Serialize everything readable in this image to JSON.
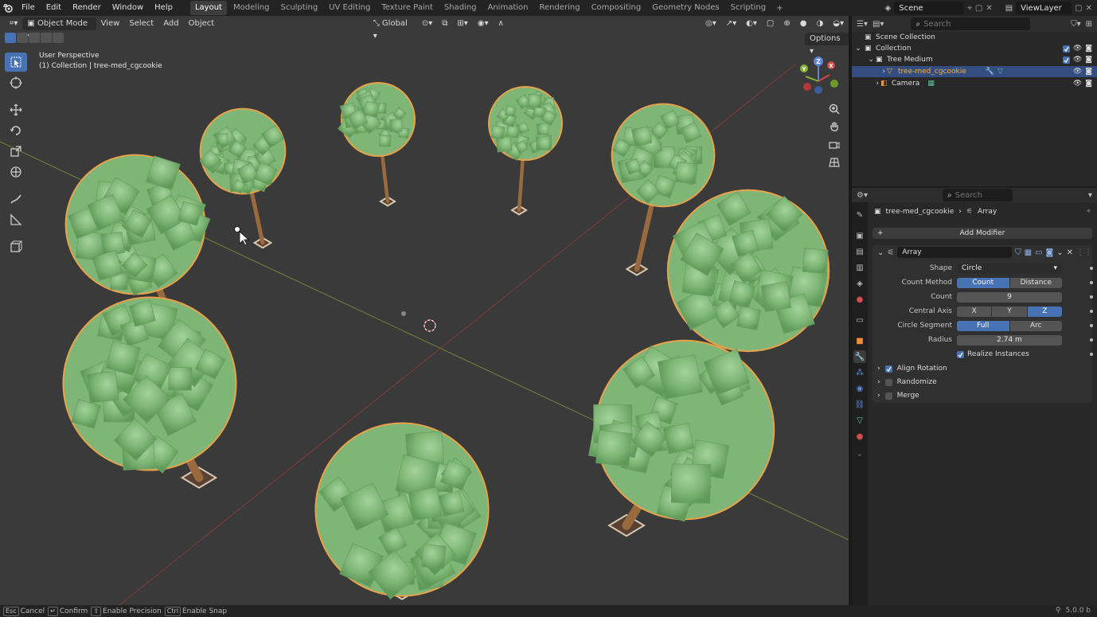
{
  "topbar": {
    "menus": [
      "File",
      "Edit",
      "Render",
      "Window",
      "Help"
    ],
    "workspaces": [
      "Layout",
      "Modeling",
      "Sculpting",
      "UV Editing",
      "Texture Paint",
      "Shading",
      "Animation",
      "Rendering",
      "Compositing",
      "Geometry Nodes",
      "Scripting"
    ],
    "active_workspace": "Layout",
    "scene": "Scene",
    "view_layer": "ViewLayer"
  },
  "viewport": {
    "mode": "Object Mode",
    "menus": [
      "View",
      "Select",
      "Add",
      "Object"
    ],
    "transform_orientation": "Global",
    "options": "Options",
    "perspective_label": "User Perspective",
    "collection_label": "(1) Collection | tree-med_cgcookie",
    "gizmo_axes": {
      "x": "X",
      "y": "Y",
      "z": "Z"
    },
    "colors": {
      "background": "#3a3a3a",
      "foliage": "#7fb577",
      "foliage_outline": "#e8a24a",
      "trunk": "#9a6a3f",
      "x_axis": "#a23a3a",
      "y_axis": "#8aa33a"
    }
  },
  "outliner": {
    "search_placeholder": "Search",
    "rows": [
      {
        "label": "Scene Collection"
      },
      {
        "label": "Collection"
      },
      {
        "label": "Tree Medium"
      },
      {
        "label": "tree-med_cgcookie"
      },
      {
        "label": "Camera"
      }
    ]
  },
  "properties": {
    "search_placeholder": "Search",
    "breadcrumb_object": "tree-med_cgcookie",
    "breadcrumb_modifier": "Array",
    "add_modifier": "Add Modifier",
    "modifier_name": "Array",
    "shape_label": "Shape",
    "shape_value": "Circle",
    "count_method_label": "Count Method",
    "count_method_options": [
      "Count",
      "Distance"
    ],
    "count_label": "Count",
    "count_value": "9",
    "central_axis_label": "Central Axis",
    "central_axis_options": [
      "X",
      "Y",
      "Z"
    ],
    "circle_segment_label": "Circle Segment",
    "circle_segment_options": [
      "Full",
      "Arc"
    ],
    "radius_label": "Radius",
    "radius_value": "2.74 m",
    "realize_instances": "Realize Instances",
    "subpanels": [
      "Align Rotation",
      "Randomize",
      "Merge"
    ]
  },
  "statusbar": {
    "items": [
      {
        "key": "Esc",
        "label": "Cancel"
      },
      {
        "key": "↵",
        "label": "Confirm"
      },
      {
        "key": "⇧",
        "label": "Enable Precision"
      },
      {
        "key": "Ctrl",
        "label": "Enable Snap"
      }
    ],
    "version": "5.0.0 b"
  }
}
